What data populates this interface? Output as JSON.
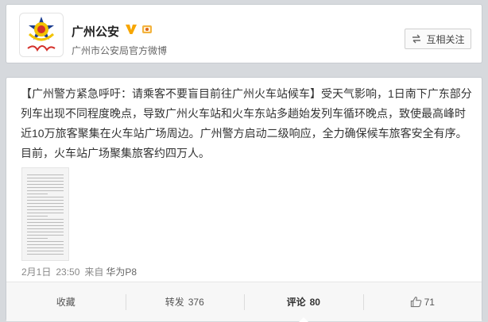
{
  "profile": {
    "name": "广州公安",
    "description": "广州市公安局官方微博",
    "avatar_icon": "police-badge-icon",
    "verified_icon": "verified-v-icon",
    "medal_icon": "medal-icon",
    "follow_label": "互相关注",
    "follow_icon": "mutual-follow-icon",
    "colors": {
      "verified": "#f7a600",
      "police_blue": "#1a3c8f",
      "police_red": "#d4302a"
    }
  },
  "post": {
    "headline": "【广州警方紧急呼吁：请乘客不要盲目前往广州火车站候车】",
    "body": "受天气影响，1日南下广东部分列车出现不同程度晚点，导致广州火车站和火车东站多趟始发列车循环晚点，致使最高峰时近10万旅客聚集在火车站广场周边。广州警方启动二级响应，全力确保候车旅客安全有序。目前，火车站广场聚集旅客约四万人。",
    "image_alt_icon": "document-thumbnail-icon",
    "date": "2月1日",
    "time": "23:50",
    "source_prefix": "来自",
    "source": "华为P8"
  },
  "actions": {
    "favorite_label": "收藏",
    "repost_label": "转发",
    "repost_count": "376",
    "comment_label": "评论",
    "comment_count": "80",
    "like_count": "71",
    "like_icon": "thumbs-up-icon"
  }
}
